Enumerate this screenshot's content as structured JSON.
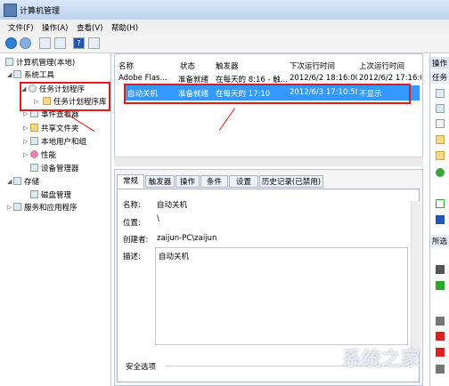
{
  "window": {
    "title": "计算机管理"
  },
  "menu": [
    "文件(F)",
    "操作(A)",
    "查看(V)",
    "帮助(H)"
  ],
  "tree": {
    "root": "计算机管理(本地)",
    "system_tools": "系统工具",
    "task_scheduler": "任务计划程序",
    "task_library": "任务计划程序库",
    "event_viewer": "事件查看器",
    "shared_folders": "共享文件夹",
    "local_users": "本地用户和组",
    "performance": "性能",
    "device_manager": "设备管理器",
    "storage": "存储",
    "disk_management": "磁盘管理",
    "services": "服务和应用程序"
  },
  "list": {
    "columns": [
      "名称",
      "状态",
      "触发器",
      "下次运行时间",
      "上次运行时间"
    ],
    "rows": [
      {
        "name": "Adobe Flas...",
        "status": "准备就绪",
        "trigger": "在每天的 8:16 - 触...",
        "next": "2012/6/2 18:16:00",
        "last": "2012/6/2 17:16:0"
      },
      {
        "name": "自动关机",
        "status": "准备就绪",
        "trigger": "在每天的 17:10",
        "next": "2012/6/3 17:10:58",
        "last": "不显示"
      }
    ]
  },
  "tabs": [
    "常规",
    "触发器",
    "操作",
    "条件",
    "设置",
    "历史记录(已禁用)"
  ],
  "details": {
    "name_label": "名称:",
    "name_value": "自动关机",
    "location_label": "位置:",
    "location_value": "\\",
    "author_label": "创建者:",
    "author_value": "zaijun-PC\\zaijun",
    "desc_label": "描述:",
    "desc_value": "自动关机",
    "security_label": "安全选项"
  },
  "actions": {
    "header": "操作",
    "sub1": "任务",
    "sub2": "所选"
  },
  "watermark": "系统之家",
  "colors": {
    "selection": "#3399ff",
    "annotation": "#e41b1b"
  }
}
